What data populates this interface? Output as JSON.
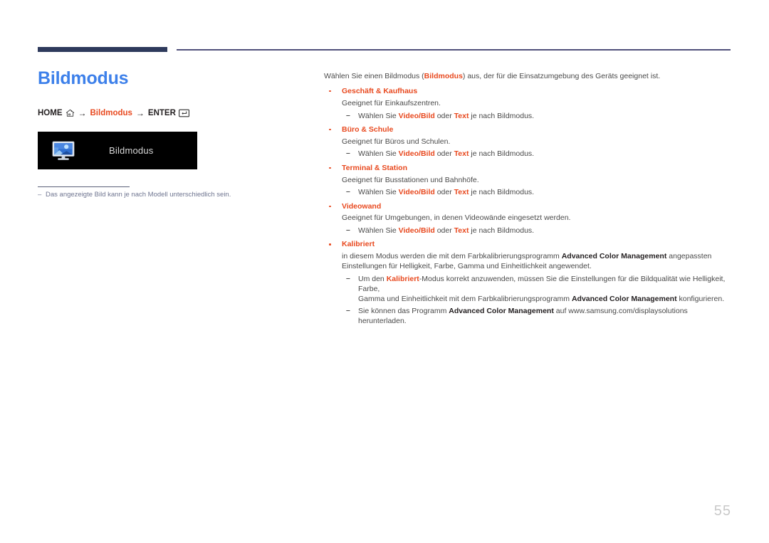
{
  "header": {
    "rule_accent_color": "#2e3a5c",
    "rule_thin_color": "#50507a"
  },
  "title": {
    "text": "Bildmodus",
    "color": "#3d80ea"
  },
  "breadcrumb": {
    "home_label": "HOME",
    "home_icon": "house-icon",
    "arrow1": "→",
    "middle_label": "Bildmodus",
    "arrow2": "→",
    "enter_label": "ENTER",
    "enter_icon": "enter-key-icon",
    "accent_color": "#e8491f"
  },
  "osd_preview": {
    "icon_name": "picture-mode-monitor-icon",
    "label": "Bildmodus",
    "background": "#000000"
  },
  "note": {
    "dash": "–",
    "text": "Das angezeigte Bild kann je nach Modell unterschiedlich sein.",
    "color": "#6f7590"
  },
  "content": {
    "intro": {
      "p1": "Wählen Sie einen Bildmodus (",
      "highlight": "Bildmodus",
      "p2": ") aus, der für die Einsatzumgebung des Geräts geeignet ist."
    },
    "items": [
      {
        "title": "Geschäft & Kaufhaus",
        "desc": "Geeignet für Einkaufszentren.",
        "sub": [
          {
            "dash": "–",
            "pre": "Wählen Sie ",
            "b1": "Video/Bild",
            "mid": " oder ",
            "b2": "Text",
            "post": " je nach Bildmodus."
          }
        ]
      },
      {
        "title": "Büro & Schule",
        "desc": "Geeignet für Büros und Schulen.",
        "sub": [
          {
            "dash": "–",
            "pre": "Wählen Sie ",
            "b1": "Video/Bild",
            "mid": " oder ",
            "b2": "Text",
            "post": " je nach Bildmodus."
          }
        ]
      },
      {
        "title": "Terminal & Station",
        "desc": "Geeignet für Busstationen und Bahnhöfe.",
        "sub": [
          {
            "dash": "–",
            "pre": "Wählen Sie ",
            "b1": "Video/Bild",
            "mid": " oder ",
            "b2": "Text",
            "post": " je nach Bildmodus."
          }
        ]
      },
      {
        "title": "Videowand",
        "desc": "Geeignet für Umgebungen, in denen Videowände eingesetzt werden.",
        "sub": [
          {
            "dash": "–",
            "pre": "Wählen Sie ",
            "b1": "Video/Bild",
            "mid": " oder ",
            "b2": "Text",
            "post": " je nach Bildmodus."
          }
        ]
      }
    ],
    "calibrated": {
      "title": "Kalibriert",
      "desc_pre": "in diesem Modus werden die mit dem Farbkalibrierungsprogramm ",
      "desc_bold": "Advanced Color Management",
      "desc_post": " angepassten",
      "desc_line2": "Einstellungen für Helligkeit, Farbe, Gamma und Einheitlichkeit angewendet.",
      "sub": [
        {
          "dash": "–",
          "pre": "Um den ",
          "accent": "Kalibriert",
          "mid": "-Modus korrekt anzuwenden, müssen Sie die Einstellungen für die Bildqualität wie Helligkeit, Farbe,",
          "line2_pre": "Gamma und Einheitlichkeit mit dem Farbkalibrierungsprogramm ",
          "line2_bold": "Advanced Color Management",
          "line2_post": " konfigurieren."
        },
        {
          "dash": "–",
          "pre": "Sie können das Programm ",
          "bold": "Advanced Color Management",
          "post": " auf www.samsung.com/displaysolutions herunterladen."
        }
      ]
    }
  },
  "footer": {
    "page_number": "55"
  }
}
